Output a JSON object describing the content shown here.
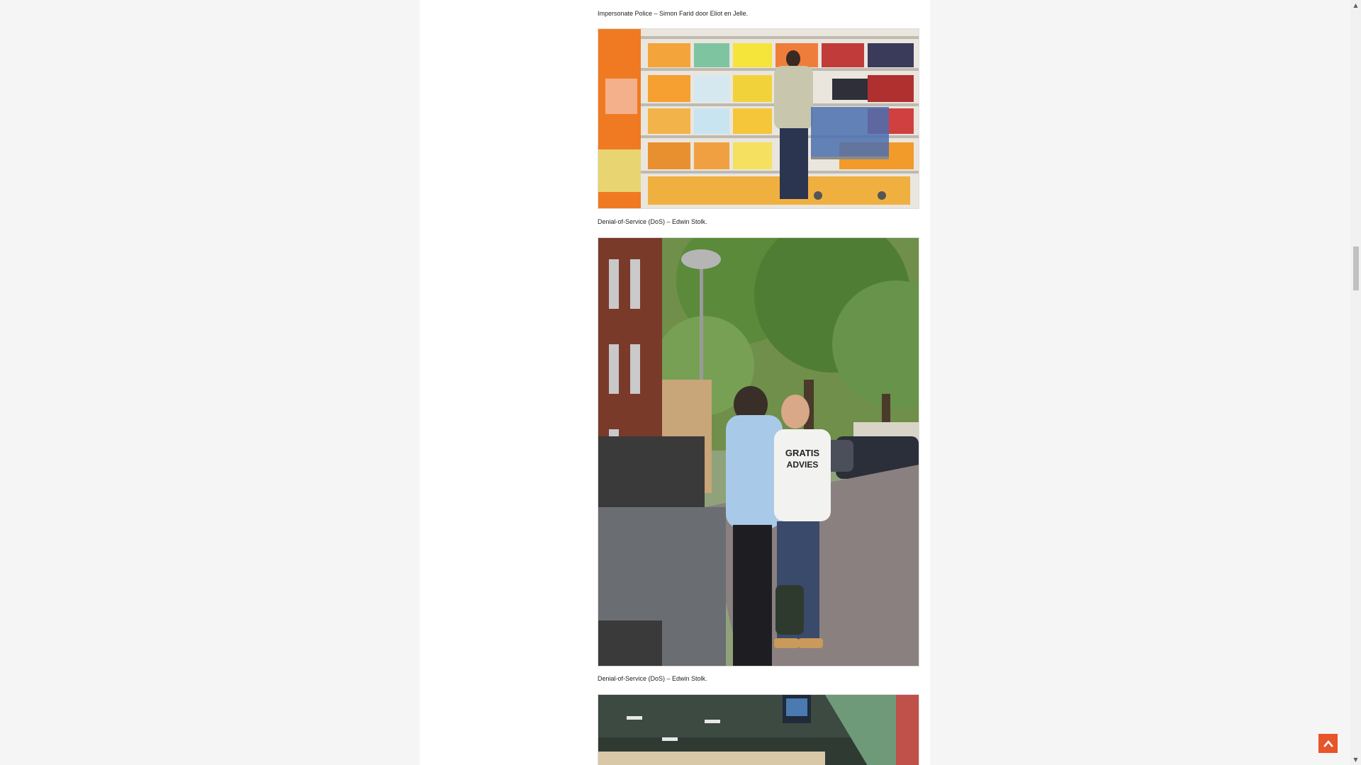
{
  "captions": {
    "caption1": "Impersonate Police – Simon Farid door Eliot en Jelle.",
    "caption2": "Denial-of-Service (DoS) – Edwin Stolk.",
    "caption3": "Denial-of-Service (DoS) – Edwin Stolk."
  },
  "photos": {
    "photo1_alt": "supermarket aisle with shopper and cart",
    "photo2_alt": "two men talking on a tree-lined street",
    "photo3_alt": "train station interior"
  },
  "photo2_text": {
    "shirt_line1": "GRATIS",
    "shirt_line2": "ADVIES"
  },
  "colors": {
    "accent": "#e8542b",
    "page_bg": "#f5f5f5",
    "column_bg": "#ffffff"
  },
  "icons": {
    "back_to_top": "chevron-up-icon",
    "scroll_up": "triangle-up-icon",
    "scroll_down": "triangle-down-icon"
  }
}
